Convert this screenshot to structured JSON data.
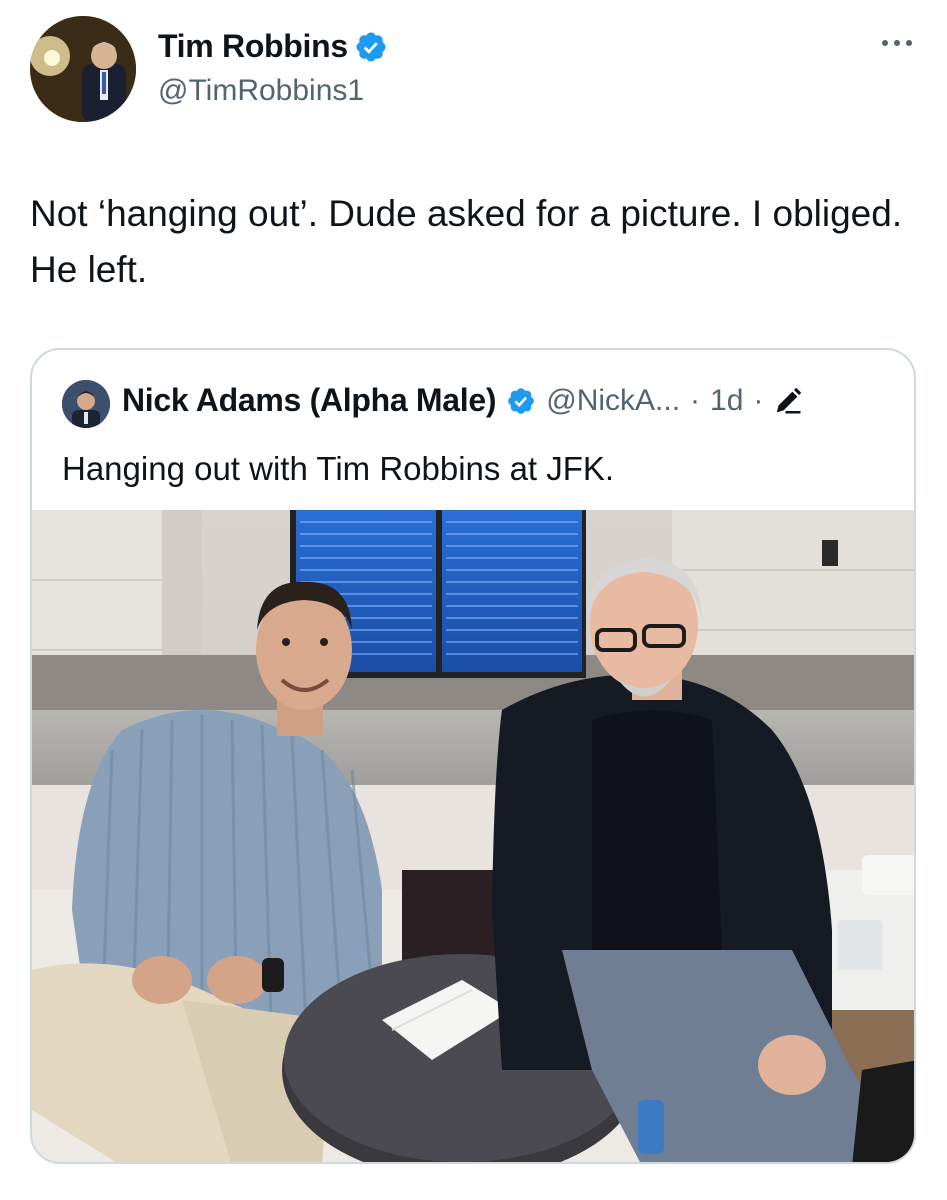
{
  "tweet": {
    "author_name": "Tim Robbins",
    "author_handle": "@TimRobbins1",
    "text": "Not ‘hanging out’.  Dude asked for a picture. I obliged. He left.",
    "more_icon": "ellipsis-icon",
    "verified_icon": "verified-badge-icon"
  },
  "quote": {
    "author_name": "Nick Adams (Alpha Male)",
    "author_handle": "@NickA...",
    "separator": "·",
    "time": "1d",
    "edit_icon": "pencil-icon",
    "text": "Hanging out with Tim Robbins at JFK."
  },
  "colors": {
    "text": "#0f1419",
    "secondary": "#536471",
    "verified": "#1d9bf0",
    "border": "#cfd9de"
  }
}
